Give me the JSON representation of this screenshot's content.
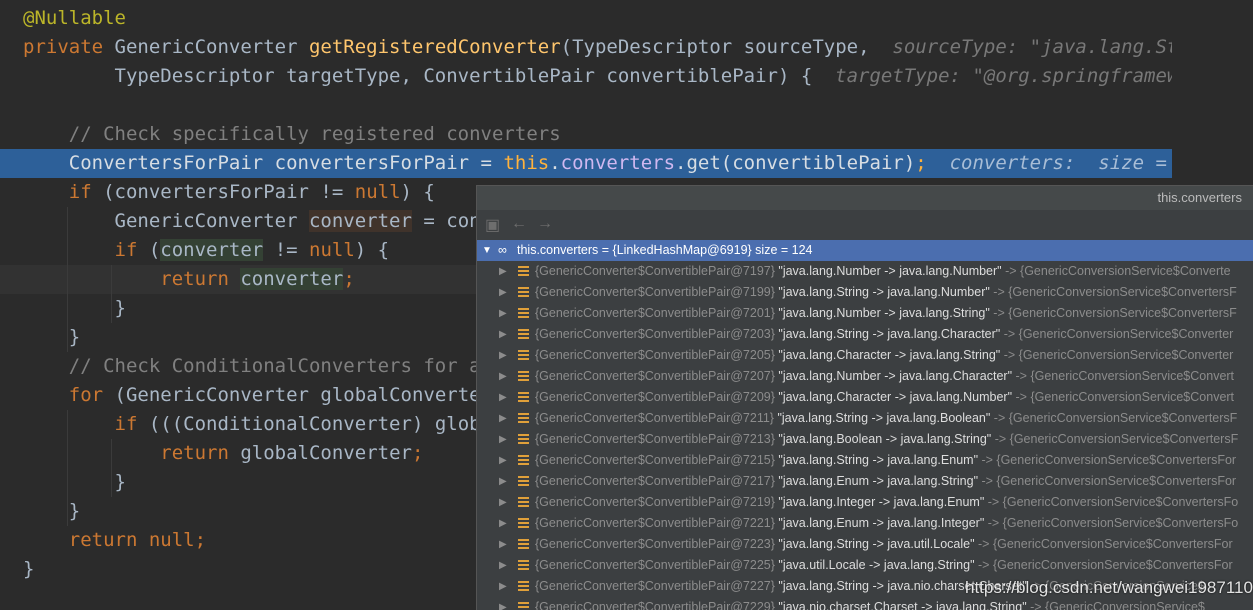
{
  "editor": {
    "lines": [
      {
        "tokens": [
          {
            "t": "@Nullable",
            "c": "ann"
          }
        ]
      },
      {
        "tokens": [
          {
            "t": "private ",
            "c": "kw"
          },
          {
            "t": "GenericConverter ",
            "c": "type"
          },
          {
            "t": "getRegisteredConverter",
            "c": "fn"
          },
          {
            "t": "(TypeDescriptor sourceType,  ",
            "c": "plain"
          },
          {
            "t": "sourceType: \"java.lang.Strin",
            "c": "hint"
          }
        ]
      },
      {
        "tokens": [
          {
            "t": "        TypeDescriptor targetType, ConvertiblePair convertiblePair) {  ",
            "c": "plain"
          },
          {
            "t": "targetType: \"@org.springframework",
            "c": "hint"
          }
        ]
      },
      {
        "tokens": []
      },
      {
        "tokens": [
          {
            "t": "    // Check specifically registered converters",
            "c": "cmt"
          }
        ]
      },
      {
        "tokens": [
          {
            "t": "    ConvertersForPair convertersForPair = ",
            "c": "plain"
          },
          {
            "t": "this",
            "c": "kw"
          },
          {
            "t": ".",
            "c": "plain"
          },
          {
            "t": "converters",
            "c": "field"
          },
          {
            "t": ".get(convertiblePair)",
            "c": "plain"
          },
          {
            "t": ";  ",
            "c": "kw"
          },
          {
            "t": "converters:  size = 124",
            "c": "hint"
          }
        ]
      },
      {
        "tokens": [
          {
            "t": "    ",
            "c": "plain"
          },
          {
            "t": "if ",
            "c": "kw"
          },
          {
            "t": "(convertersForPair != ",
            "c": "plain"
          },
          {
            "t": "null",
            "c": "kw"
          },
          {
            "t": ") {",
            "c": "plain"
          }
        ]
      },
      {
        "tokens": [
          {
            "t": "        GenericConverter ",
            "c": "plain"
          },
          {
            "t": "converter",
            "c": "plain",
            "h": "write"
          },
          {
            "t": " = conv",
            "c": "plain"
          }
        ]
      },
      {
        "tokens": [
          {
            "t": "        ",
            "c": "plain"
          },
          {
            "t": "if ",
            "c": "kw"
          },
          {
            "t": "(",
            "c": "plain"
          },
          {
            "t": "converter",
            "c": "plain",
            "h": "read"
          },
          {
            "t": " != ",
            "c": "plain"
          },
          {
            "t": "null",
            "c": "kw"
          },
          {
            "t": ") {",
            "c": "plain"
          }
        ]
      },
      {
        "tokens": [
          {
            "t": "            ",
            "c": "plain"
          },
          {
            "t": "return ",
            "c": "kw"
          },
          {
            "t": "converter",
            "c": "plain",
            "h": "read"
          },
          {
            "t": ";",
            "c": "kw"
          }
        ]
      },
      {
        "tokens": [
          {
            "t": "        }",
            "c": "plain"
          }
        ]
      },
      {
        "tokens": [
          {
            "t": "    }",
            "c": "plain"
          }
        ]
      },
      {
        "tokens": [
          {
            "t": "    // Check ConditionalConverters for a",
            "c": "cmt"
          }
        ]
      },
      {
        "tokens": [
          {
            "t": "    ",
            "c": "plain"
          },
          {
            "t": "for ",
            "c": "kw"
          },
          {
            "t": "(GenericConverter globalConverter",
            "c": "plain"
          }
        ]
      },
      {
        "tokens": [
          {
            "t": "        ",
            "c": "plain"
          },
          {
            "t": "if ",
            "c": "kw"
          },
          {
            "t": "(((ConditionalConverter) globa",
            "c": "plain"
          }
        ]
      },
      {
        "tokens": [
          {
            "t": "            ",
            "c": "plain"
          },
          {
            "t": "return ",
            "c": "kw"
          },
          {
            "t": "globalConverter",
            "c": "plain"
          },
          {
            "t": ";",
            "c": "kw"
          }
        ]
      },
      {
        "tokens": [
          {
            "t": "        }",
            "c": "plain"
          }
        ]
      },
      {
        "tokens": [
          {
            "t": "    }",
            "c": "plain"
          }
        ]
      },
      {
        "tokens": [
          {
            "t": "    ",
            "c": "plain"
          },
          {
            "t": "return null",
            "c": "kw"
          },
          {
            "t": ";",
            "c": "kw"
          }
        ]
      },
      {
        "tokens": [
          {
            "t": "}",
            "c": "plain"
          }
        ]
      }
    ],
    "execution_line_index": 5,
    "caret_line_index": 9
  },
  "popup": {
    "title": "this.converters",
    "toolbar_icons": [
      "pin-icon",
      "back-arrow-icon",
      "forward-arrow-icon"
    ],
    "root": {
      "label": "this.converters = {LinkedHashMap@6919}  size = 124",
      "icon": "watch-glasses-icon"
    },
    "entries": [
      {
        "obj": "{GenericConverter$ConvertiblePair@7197}",
        "key": "\"java.lang.Number -> java.lang.Number\"",
        "value": " -> {GenericConversionService$Converte"
      },
      {
        "obj": "{GenericConverter$ConvertiblePair@7199}",
        "key": "\"java.lang.String -> java.lang.Number\"",
        "value": " -> {GenericConversionService$ConvertersF"
      },
      {
        "obj": "{GenericConverter$ConvertiblePair@7201}",
        "key": "\"java.lang.Number -> java.lang.String\"",
        "value": " -> {GenericConversionService$ConvertersF"
      },
      {
        "obj": "{GenericConverter$ConvertiblePair@7203}",
        "key": "\"java.lang.String -> java.lang.Character\"",
        "value": " -> {GenericConversionService$Converter"
      },
      {
        "obj": "{GenericConverter$ConvertiblePair@7205}",
        "key": "\"java.lang.Character -> java.lang.String\"",
        "value": " -> {GenericConversionService$Converter"
      },
      {
        "obj": "{GenericConverter$ConvertiblePair@7207}",
        "key": "\"java.lang.Number -> java.lang.Character\"",
        "value": " -> {GenericConversionService$Convert"
      },
      {
        "obj": "{GenericConverter$ConvertiblePair@7209}",
        "key": "\"java.lang.Character -> java.lang.Number\"",
        "value": " -> {GenericConversionService$Convert"
      },
      {
        "obj": "{GenericConverter$ConvertiblePair@7211}",
        "key": "\"java.lang.String -> java.lang.Boolean\"",
        "value": " -> {GenericConversionService$ConvertersF"
      },
      {
        "obj": "{GenericConverter$ConvertiblePair@7213}",
        "key": "\"java.lang.Boolean -> java.lang.String\"",
        "value": " -> {GenericConversionService$ConvertersF"
      },
      {
        "obj": "{GenericConverter$ConvertiblePair@7215}",
        "key": "\"java.lang.String -> java.lang.Enum\"",
        "value": " -> {GenericConversionService$ConvertersFor"
      },
      {
        "obj": "{GenericConverter$ConvertiblePair@7217}",
        "key": "\"java.lang.Enum -> java.lang.String\"",
        "value": " -> {GenericConversionService$ConvertersFor"
      },
      {
        "obj": "{GenericConverter$ConvertiblePair@7219}",
        "key": "\"java.lang.Integer -> java.lang.Enum\"",
        "value": " -> {GenericConversionService$ConvertersFo"
      },
      {
        "obj": "{GenericConverter$ConvertiblePair@7221}",
        "key": "\"java.lang.Enum -> java.lang.Integer\"",
        "value": " -> {GenericConversionService$ConvertersFo"
      },
      {
        "obj": "{GenericConverter$ConvertiblePair@7223}",
        "key": "\"java.lang.String -> java.util.Locale\"",
        "value": " -> {GenericConversionService$ConvertersFor"
      },
      {
        "obj": "{GenericConverter$ConvertiblePair@7225}",
        "key": "\"java.util.Locale -> java.lang.String\"",
        "value": " -> {GenericConversionService$ConvertersFor"
      },
      {
        "obj": "{GenericConverter$ConvertiblePair@7227}",
        "key": "\"java.lang.String -> java.nio.charset.Charset\"",
        "value": " -> {GenericConversionService$"
      },
      {
        "obj": "{GenericConverter$ConvertiblePair@7229}",
        "key": "\"java.nio.charset.Charset -> java.lang.String\"",
        "value": " -> {GenericConversionService$"
      }
    ]
  },
  "watermark": "https://blog.csdn.net/wangwei19871103",
  "colors": {
    "editor_bg": "#2b2b2b",
    "execution_line": "#2d6099",
    "popup_bg": "#3c3f41",
    "selection_row": "#4b6eaf",
    "field_icon": "#e0a03a"
  }
}
